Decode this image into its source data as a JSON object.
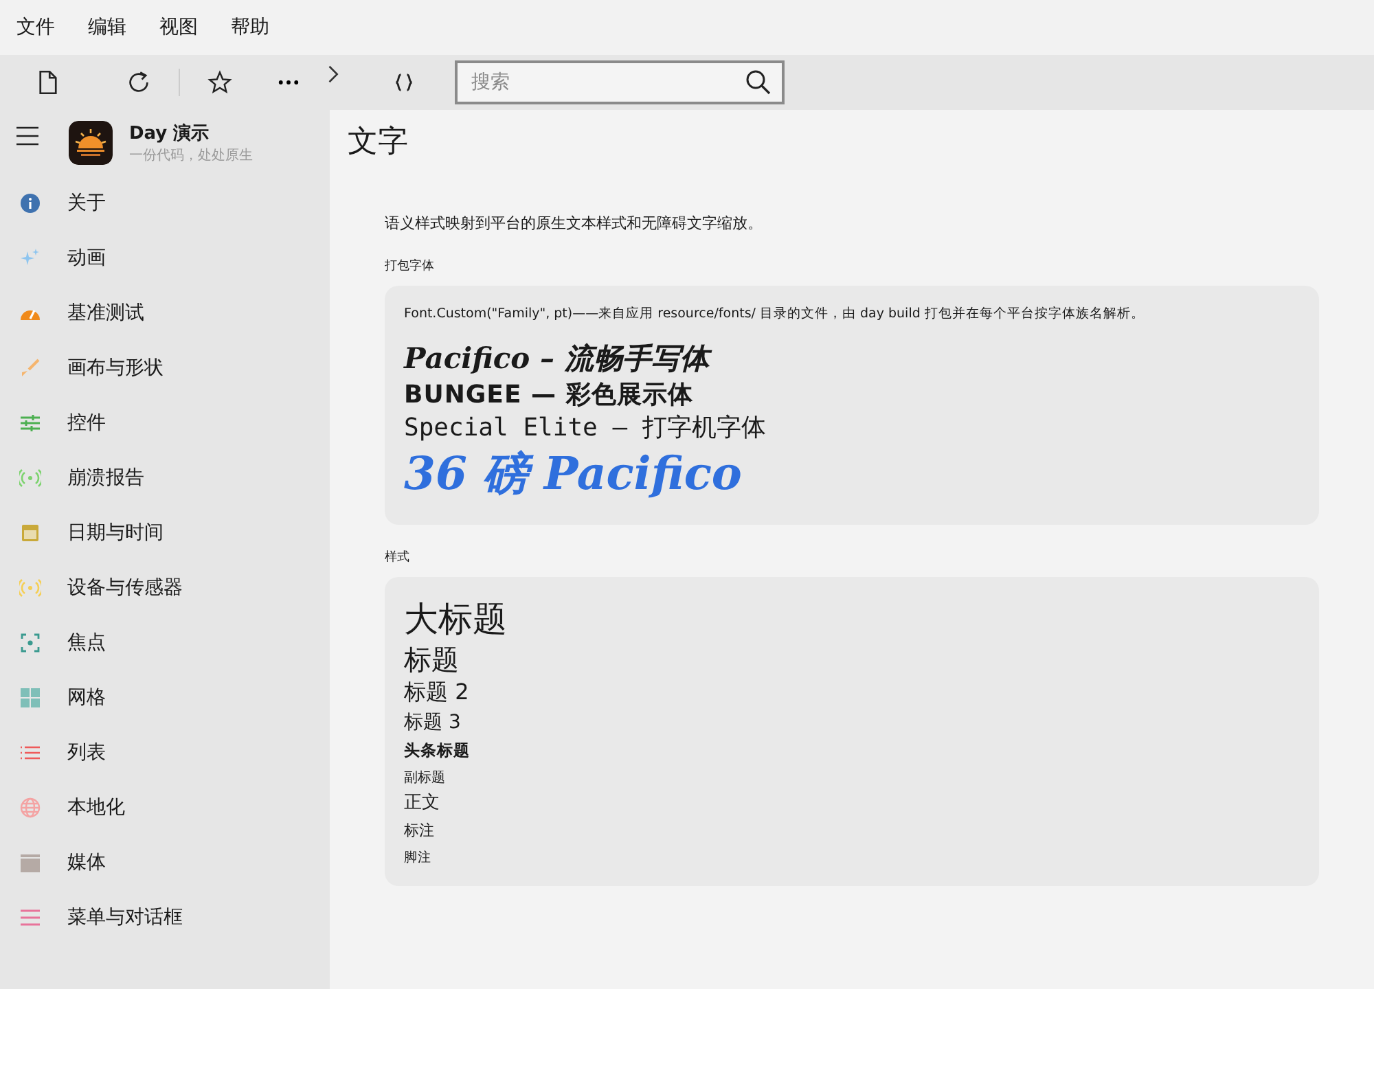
{
  "menu_bar": [
    "文件",
    "编辑",
    "视图",
    "帮助"
  ],
  "toolbar": {
    "search": {
      "placeholder": "搜索"
    }
  },
  "sidebar": {
    "app_name": "Day 演示",
    "app_tagline": "一份代码，处处原生",
    "items": [
      {
        "label": "关于",
        "kind": "info",
        "color": "#3f72af"
      },
      {
        "label": "动画",
        "kind": "sparkle",
        "color": "#8ec5ef"
      },
      {
        "label": "基准测试",
        "kind": "gauge",
        "color": "#f08a1a"
      },
      {
        "label": "画布与形状",
        "kind": "brush",
        "color": "#f5b56e"
      },
      {
        "label": "控件",
        "kind": "sliders",
        "color": "#4caf50"
      },
      {
        "label": "崩溃报告",
        "kind": "signal",
        "color": "#7dd36f"
      },
      {
        "label": "日期与时间",
        "kind": "calendar",
        "color": "#c9a93a"
      },
      {
        "label": "设备与传感器",
        "kind": "signal",
        "color": "#f5cf55"
      },
      {
        "label": "焦点",
        "kind": "focus",
        "color": "#3a9a8f"
      },
      {
        "label": "网格",
        "kind": "grid",
        "color": "#7fbfb8"
      },
      {
        "label": "列表",
        "kind": "list",
        "color": "#ef5a5a"
      },
      {
        "label": "本地化",
        "kind": "globe",
        "color": "#f4a3a3"
      },
      {
        "label": "媒体",
        "kind": "clapper",
        "color": "#b5aaa5"
      },
      {
        "label": "菜单与对话框",
        "kind": "menu",
        "color": "#e8739a"
      }
    ]
  },
  "page": {
    "title": "文字",
    "description": "语义样式映射到平台的原生文本样式和无障碍文字缩放。",
    "sections": [
      {
        "heading": "打包字体",
        "note": "Font.Custom(\"Family\", pt)——来自应用 resource/fonts/ 目录的文件，由 day build 打包并在每个平台按字体族名解析。",
        "samples": [
          {
            "kind": "script",
            "text": "Pacifico – 流畅手写体"
          },
          {
            "kind": "display",
            "text": "BUNGEE — 彩色展示体"
          },
          {
            "kind": "typewriter",
            "text": "Special Elite — 打字机字体"
          },
          {
            "kind": "big",
            "text": "36 磅 Pacifico"
          }
        ]
      },
      {
        "heading": "样式",
        "samples": [
          {
            "kind": "large_title",
            "text": "大标题"
          },
          {
            "kind": "title",
            "text": "标题"
          },
          {
            "kind": "title2",
            "text": "标题 2"
          },
          {
            "kind": "title3",
            "text": "标题 3"
          },
          {
            "kind": "headline",
            "text": "头条标题"
          },
          {
            "kind": "subheadline",
            "text": "副标题"
          },
          {
            "kind": "body",
            "text": "正文"
          },
          {
            "kind": "callout",
            "text": "标注"
          },
          {
            "kind": "footnote",
            "text": "脚注"
          }
        ]
      }
    ]
  }
}
